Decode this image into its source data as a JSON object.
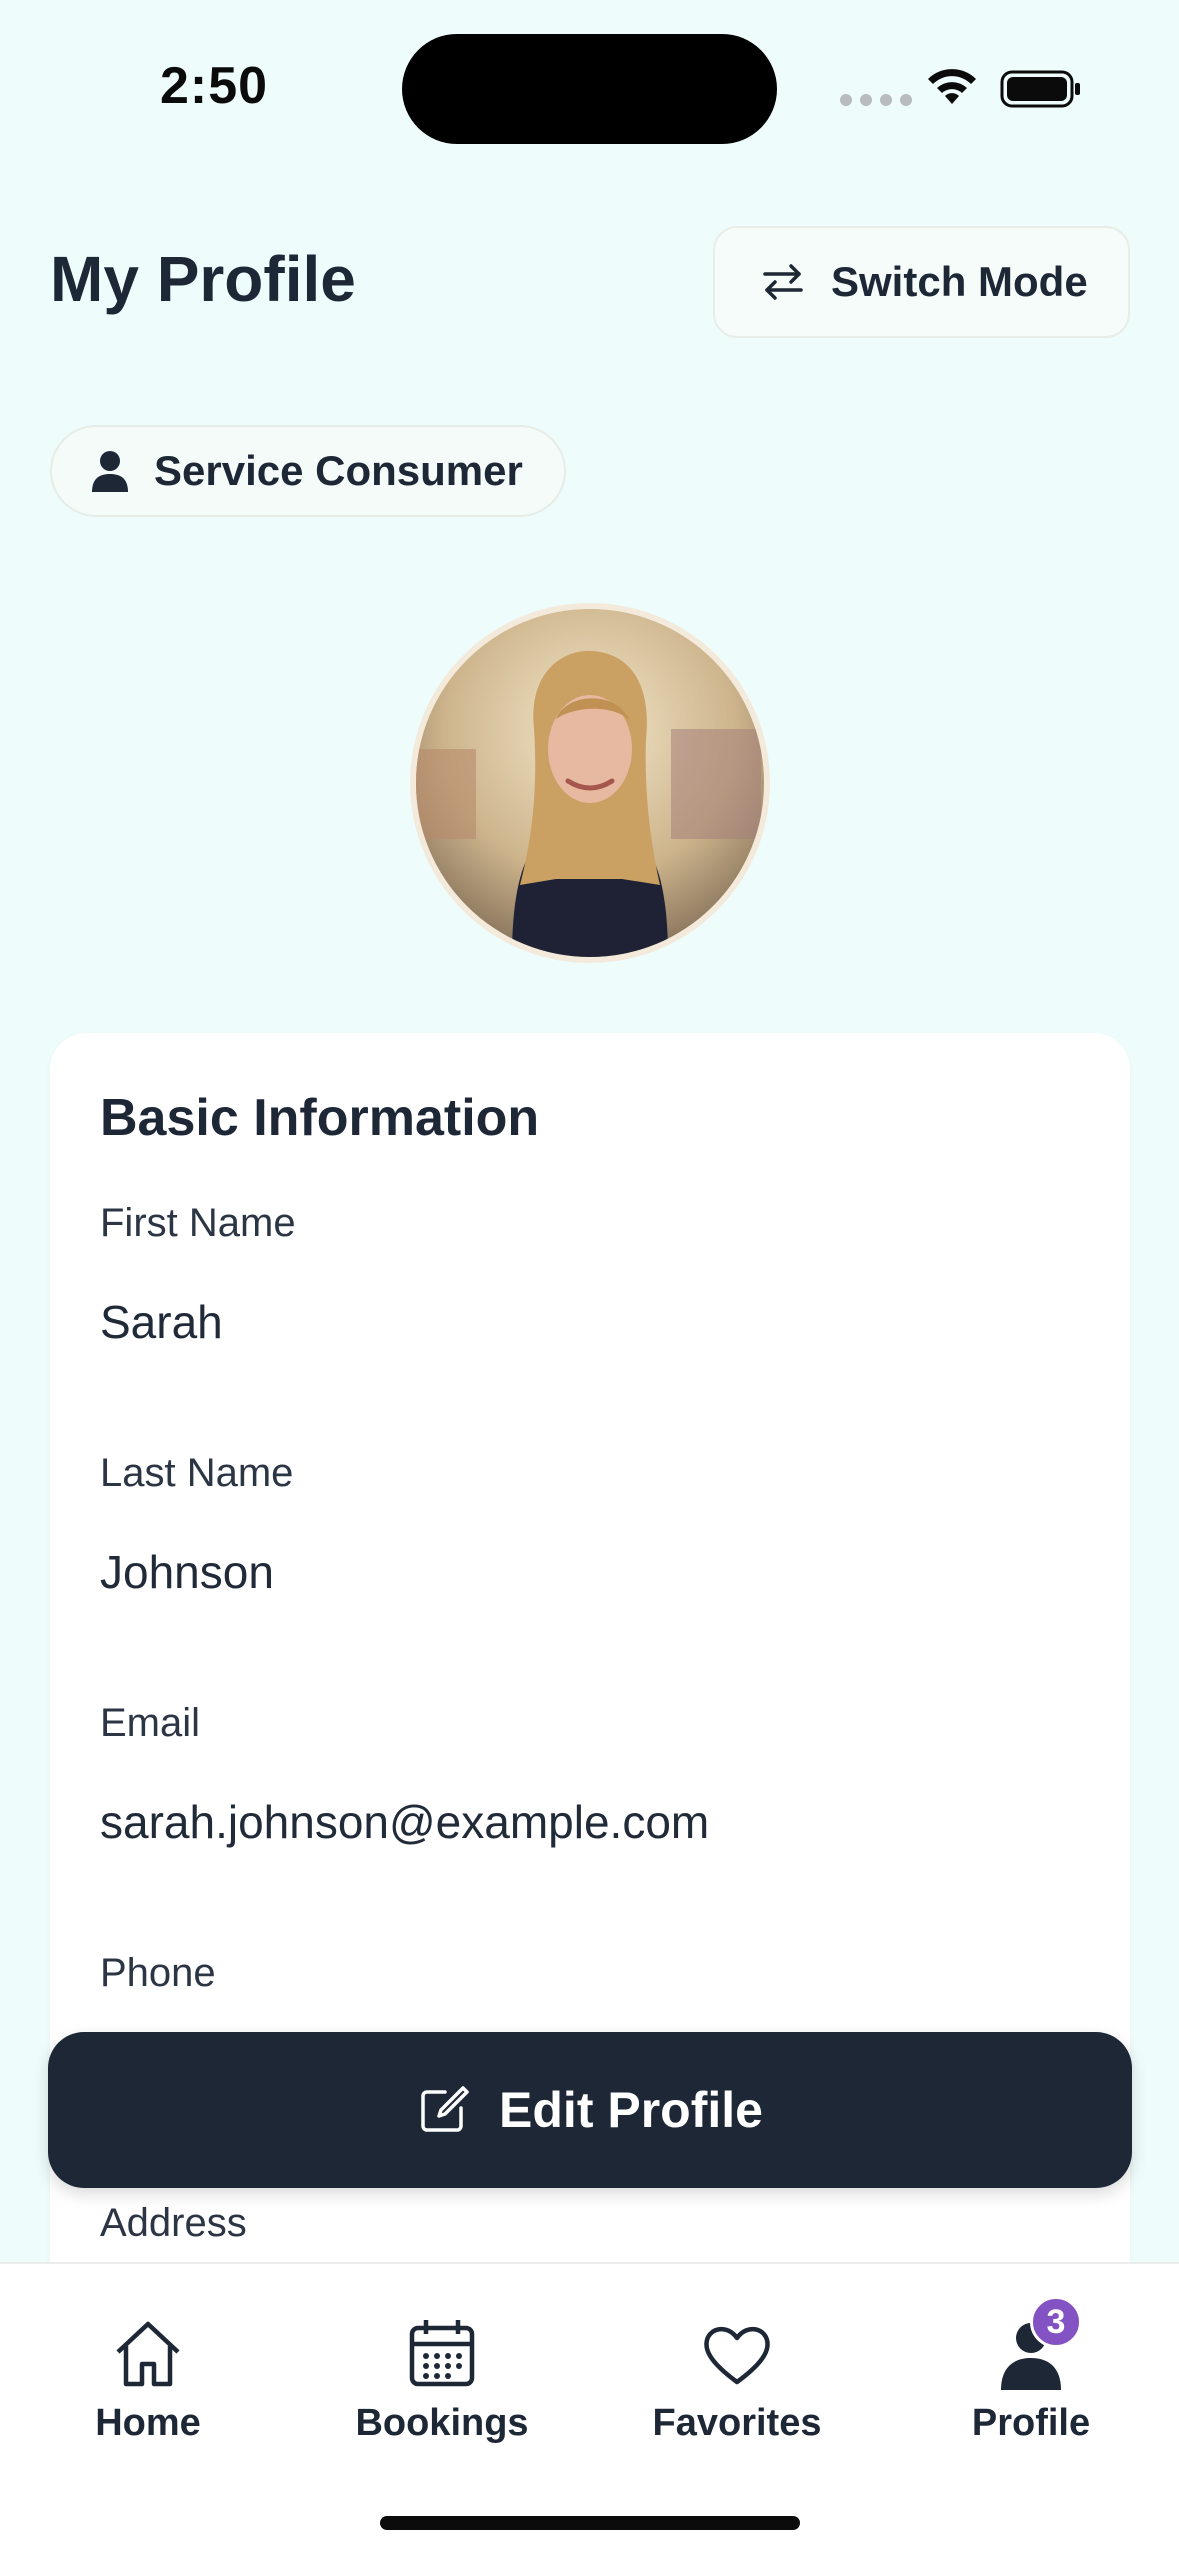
{
  "status_bar": {
    "time": "2:50"
  },
  "header": {
    "title": "My Profile",
    "switch_mode_label": "Switch Mode"
  },
  "role_chip": {
    "label": "Service Consumer"
  },
  "avatar": {
    "icon": "profile-photo"
  },
  "basic_info": {
    "title": "Basic Information",
    "fields": [
      {
        "label": "First Name",
        "value": "Sarah"
      },
      {
        "label": "Last Name",
        "value": "Johnson"
      },
      {
        "label": "Email",
        "value": "sarah.johnson@example.com"
      },
      {
        "label": "Phone",
        "value": ""
      },
      {
        "label": "Address",
        "value": ""
      }
    ]
  },
  "edit_button": {
    "label": "Edit Profile"
  },
  "tab_bar": {
    "tabs": [
      {
        "label": "Home",
        "icon": "home-icon"
      },
      {
        "label": "Bookings",
        "icon": "calendar-icon"
      },
      {
        "label": "Favorites",
        "icon": "heart-icon"
      },
      {
        "label": "Profile",
        "icon": "person-icon"
      }
    ],
    "profile_badge": "3"
  },
  "colors": {
    "background": "#effcfc",
    "primary_dark": "#1d2736",
    "badge": "#8353c3"
  }
}
